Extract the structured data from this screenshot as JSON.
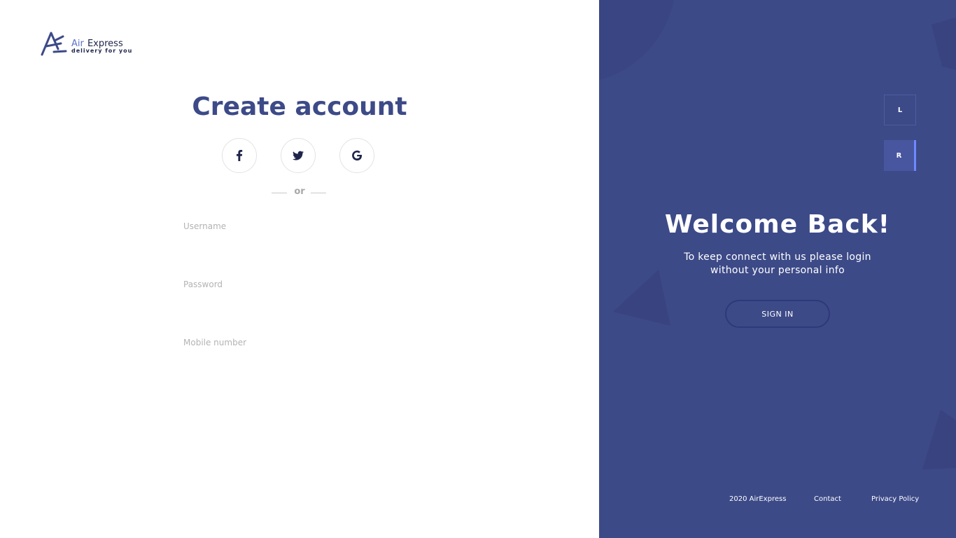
{
  "logo": {
    "brand_air": "Air",
    "brand_express": "Express",
    "tagline": "delivery for you"
  },
  "form": {
    "title": "Create account",
    "divider": "or",
    "social": [
      {
        "name": "facebook-icon"
      },
      {
        "name": "twitter-icon"
      },
      {
        "name": "google-icon"
      }
    ],
    "username_placeholder": "Username",
    "username_value": "",
    "password_placeholder": "Password",
    "password_value": "",
    "mobile_placeholder": "Mobile number",
    "mobile_value": ""
  },
  "panel": {
    "tab_left": "L",
    "tab_right": "R",
    "heading": "Welcome Back!",
    "subtitle": "To keep connect with us please login without your personal info",
    "signin_label": "SIGN IN"
  },
  "footer": {
    "copyright": "2020 AirExpress",
    "contact": "Contact",
    "privacy": "Privacy Policy"
  },
  "colors": {
    "brand": "#3d4a88",
    "accent": "#6e88ff",
    "text_dark": "#1e244a"
  }
}
